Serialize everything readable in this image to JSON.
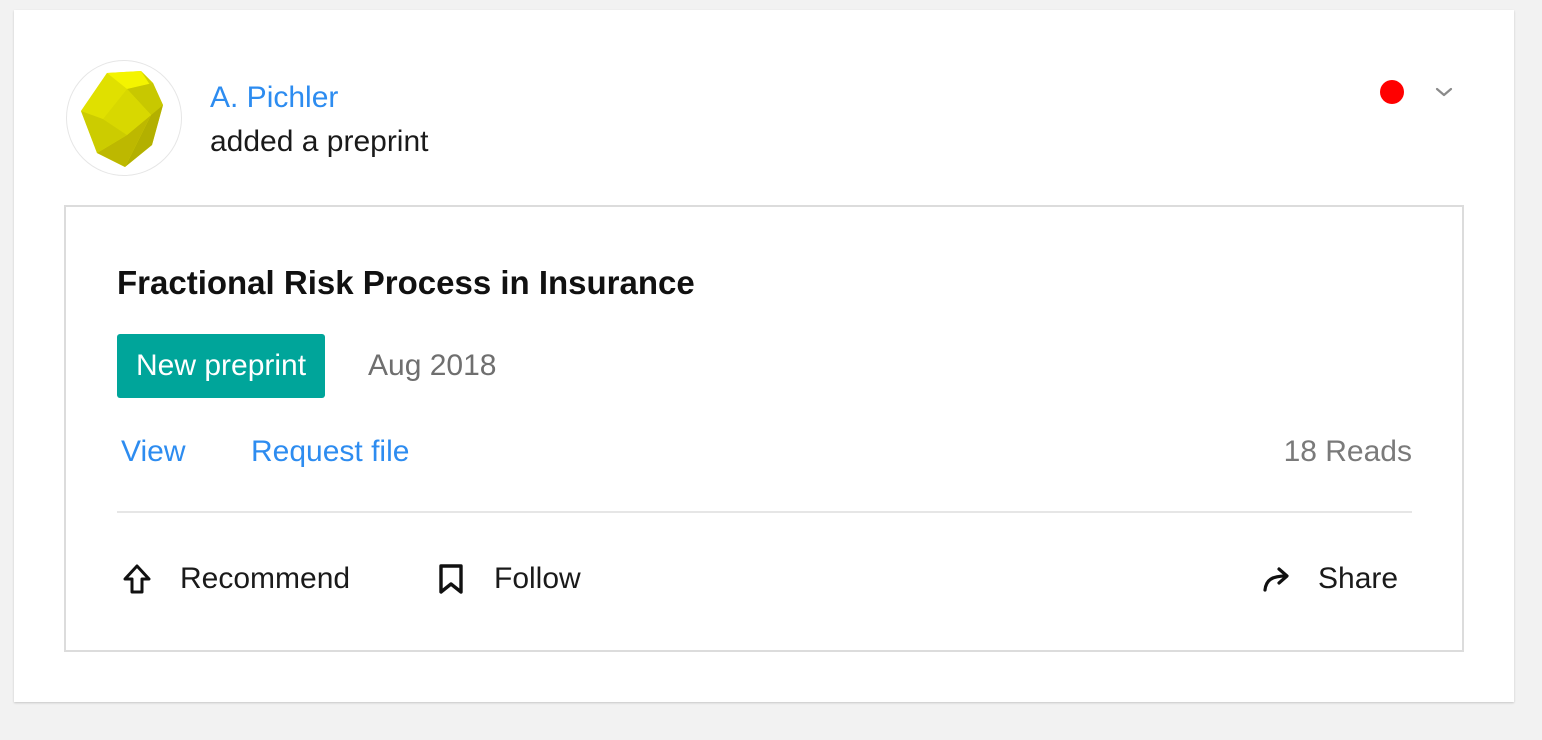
{
  "post": {
    "author": "A. Pichler",
    "action": "added a preprint",
    "avatar_icon": "yellow-polyhedron-avatar",
    "notification_color": "#ff0000",
    "menu_icon": "chevron-down-icon"
  },
  "publication": {
    "title": "Fractional Risk Process in Insurance",
    "badge": "New preprint",
    "badge_color": "#00a59a",
    "date": "Aug 2018",
    "links": {
      "view": "View",
      "request_file": "Request file"
    },
    "reads": "18 Reads"
  },
  "actions": {
    "recommend": "Recommend",
    "follow": "Follow",
    "share": "Share"
  }
}
